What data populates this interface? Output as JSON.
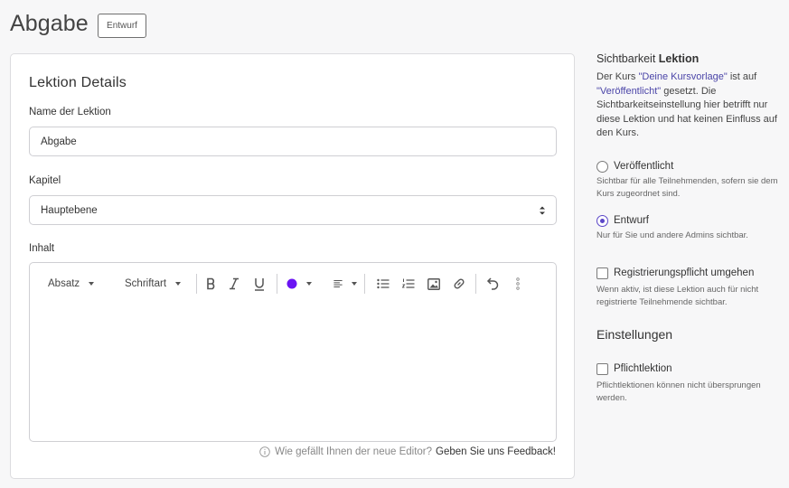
{
  "header": {
    "title": "Abgabe",
    "status_badge": "Entwurf"
  },
  "card": {
    "title": "Lektion Details",
    "name_label": "Name der Lektion",
    "name_value": "Abgabe",
    "chapter_label": "Kapitel",
    "chapter_value": "Hauptebene",
    "content_label": "Inhalt"
  },
  "editor": {
    "toolbar": {
      "paragraph_label": "Absatz",
      "font_label": "Schriftart",
      "text_color": "#6a14f3",
      "icons": [
        "bold-icon",
        "italic-icon",
        "underline-icon",
        "text-color-icon",
        "align-icon",
        "bullet-list-icon",
        "numbered-list-icon",
        "image-icon",
        "link-icon",
        "undo-icon",
        "more-icon"
      ]
    },
    "body_text": ""
  },
  "feedback": {
    "question": "Wie gefällt Ihnen der neue Editor?",
    "link": "Geben Sie uns Feedback!"
  },
  "sidebar": {
    "visibility_heading_prefix": "Sichtbarkeit",
    "visibility_heading_bold": "Lektion",
    "desc_part1": "Der Kurs ",
    "course_link": "\"Deine Kursvorlage\"",
    "desc_part2": " ist auf ",
    "status_link": "\"Veröffentlicht\"",
    "desc_part3": " gesetzt. Die Sichtbarkeitseinstellung hier betrifft nur diese Lektion und hat keinen Einfluss auf den Kurs.",
    "options": [
      {
        "label": "Veröffentlicht",
        "desc": "Sichtbar für alle Teilnehmenden, sofern sie dem Kurs zugeordnet sind.",
        "checked": false
      },
      {
        "label": "Entwurf",
        "desc": "Nur für Sie und andere Admins sichtbar.",
        "checked": true
      }
    ],
    "bypass_label": "Registrierungspflicht umgehen",
    "bypass_desc": "Wenn aktiv, ist diese Lektion auch für nicht registrierte Teilnehmende sichtbar.",
    "settings_heading": "Einstellungen",
    "required_label": "Pflichtlektion",
    "required_desc": "Pflichtlektionen können nicht übersprungen werden."
  },
  "colors": {
    "accent": "#5b47c8",
    "link": "#4b45a8",
    "border": "#cfcfd3"
  }
}
